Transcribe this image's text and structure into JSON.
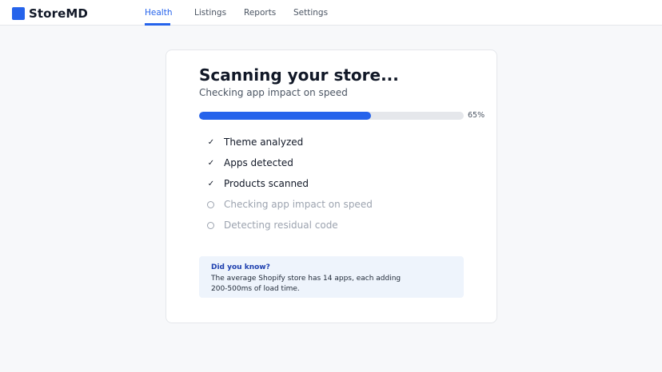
{
  "app": {
    "name": "StoreMD",
    "brand_color": "#2563eb"
  },
  "nav": {
    "tabs": [
      {
        "label": "Health",
        "active": true
      },
      {
        "label": "Listings",
        "active": false
      },
      {
        "label": "Reports",
        "active": false
      },
      {
        "label": "Settings",
        "active": false
      }
    ]
  },
  "scan": {
    "title": "Scanning your store...",
    "subtitle": "Checking app impact on speed",
    "progress_percent": 65,
    "progress_label": "65%",
    "steps": [
      {
        "label": "Theme analyzed",
        "status": "done",
        "icon": "check-icon"
      },
      {
        "label": "Apps detected",
        "status": "done",
        "icon": "check-icon"
      },
      {
        "label": "Products scanned",
        "status": "done",
        "icon": "check-icon"
      },
      {
        "label": "Checking app impact on speed",
        "status": "pending",
        "icon": "circle-icon"
      },
      {
        "label": "Detecting residual code",
        "status": "pending",
        "icon": "circle-icon"
      }
    ]
  },
  "tip": {
    "title": "Did you know?",
    "body": "The average Shopify store has 14 apps, each adding 200-500ms of load time."
  }
}
